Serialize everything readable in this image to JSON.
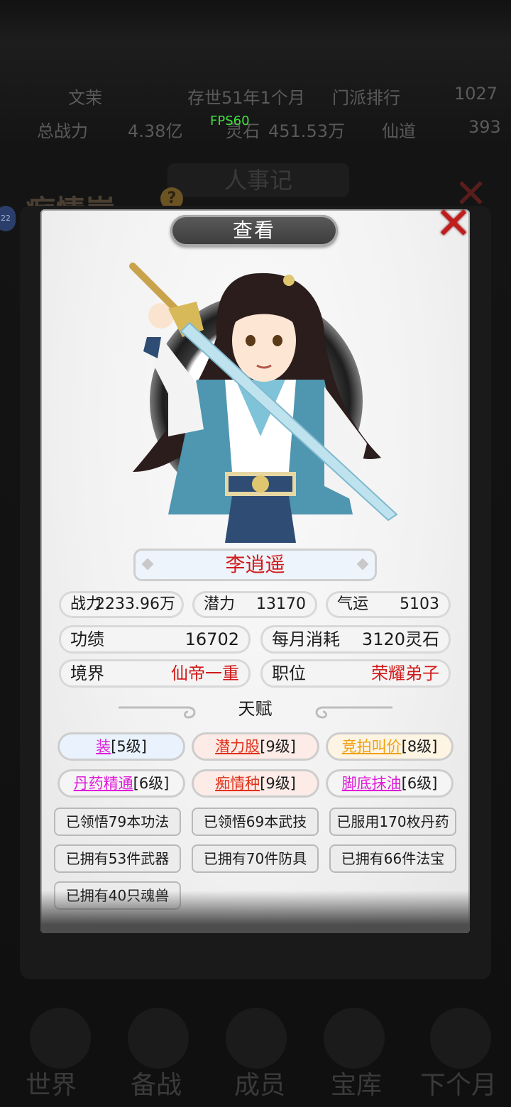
{
  "background": {
    "row1": [
      "文茉",
      "存世51年1个月",
      "门派排行",
      "1027"
    ],
    "row2": [
      "总战力",
      "4.38亿",
      "灵石",
      "451.53万",
      "仙道",
      "393"
    ],
    "fps": "FPS60",
    "page_title": "痴情崖",
    "center_title": "人事记",
    "badge": "22",
    "nav": [
      "世界",
      "备战",
      "成员",
      "宝库",
      "下个月"
    ]
  },
  "dialog": {
    "title": "查看",
    "close_icon": "close-icon",
    "character": {
      "name": "李逍遥",
      "stats": [
        {
          "label": "战力",
          "value": "2233.96万"
        },
        {
          "label": "潜力",
          "value": "13170"
        },
        {
          "label": "气运",
          "value": "5103"
        }
      ],
      "merit": {
        "label": "功绩",
        "value": "16702"
      },
      "monthly_cost": {
        "label": "每月消耗",
        "value": "3120灵石"
      },
      "realm": {
        "label": "境界",
        "value": "仙帝一重"
      },
      "position": {
        "label": "职位",
        "value": "荣耀弟子"
      }
    },
    "talent_title": "天赋",
    "talents": [
      {
        "name": "装",
        "level": "[5级]",
        "color": "#e01ad9"
      },
      {
        "name": "潜力股",
        "level": "[9级]",
        "color": "#e0311a"
      },
      {
        "name": "竞拍叫价",
        "level": "[8级]",
        "color": "#efa10d"
      },
      {
        "name": "丹药精通",
        "level": "[6级]",
        "color": "#e01ad9"
      },
      {
        "name": "痴情种",
        "level": "[9级]",
        "color": "#e0311a"
      },
      {
        "name": "脚底抹油",
        "level": "[6级]",
        "color": "#e01ad9"
      }
    ],
    "records": [
      "已领悟79本功法",
      "已领悟69本武技",
      "已服用170枚丹药",
      "已拥有53件武器",
      "已拥有70件防具",
      "已拥有66件法宝",
      "已拥有40只魂兽"
    ]
  }
}
